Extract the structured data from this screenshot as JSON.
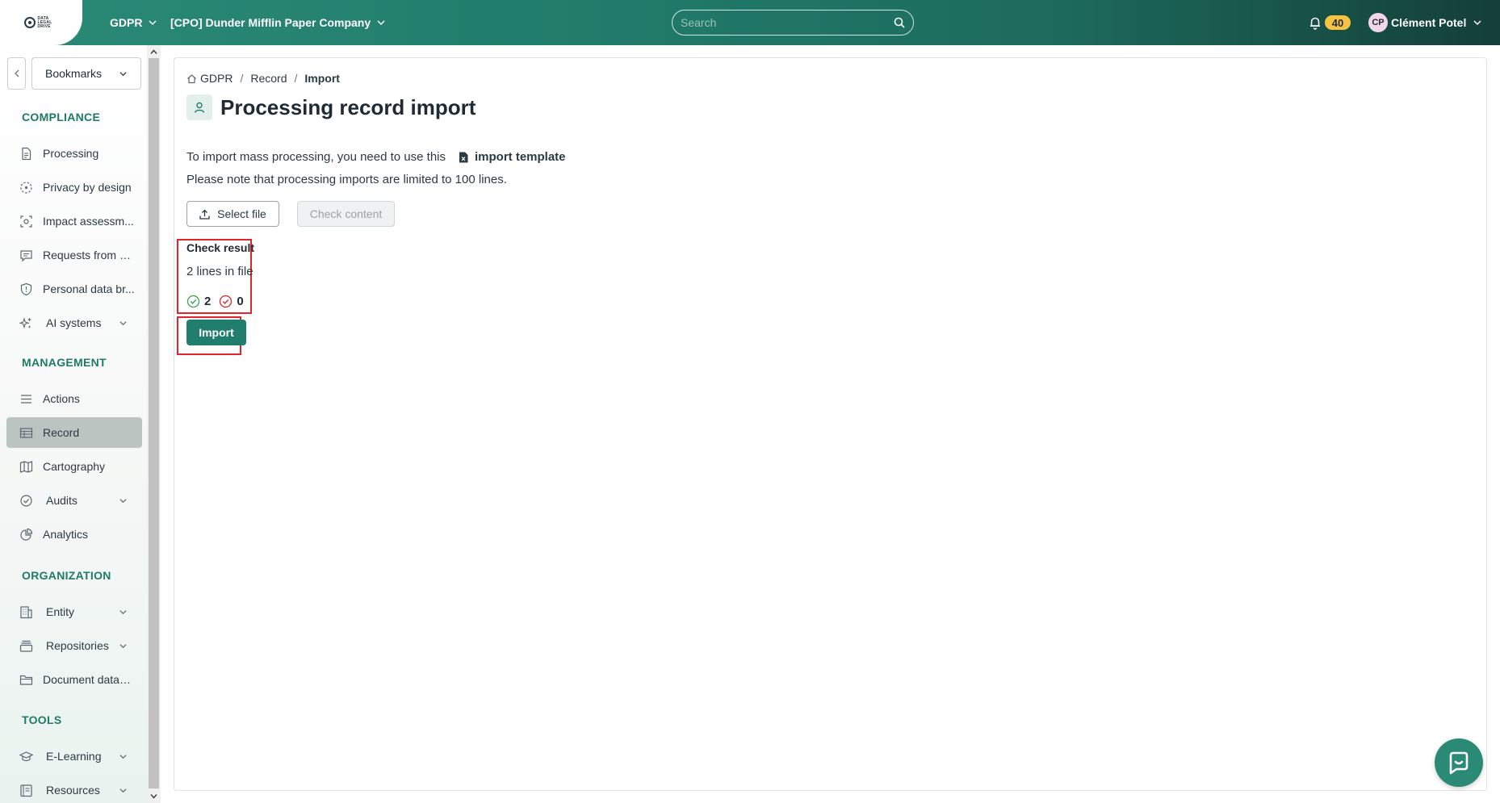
{
  "logo": {
    "text": "DATA LEGAL DRIVE"
  },
  "topbar": {
    "module": "GDPR",
    "company": "[CPO] Dunder Mifflin Paper Company",
    "search_placeholder": "Search",
    "notifications_count": "40",
    "avatar_initials": "CP",
    "user_name": "Clément Potel"
  },
  "sidebar": {
    "bookmarks_label": "Bookmarks",
    "sections": {
      "compliance": "COMPLIANCE",
      "management": "MANAGEMENT",
      "organization": "ORGANIZATION",
      "tools": "TOOLS"
    },
    "items": {
      "processing": "Processing",
      "privacy_by_design": "Privacy by design",
      "impact_assessment": "Impact assessm...",
      "requests": "Requests from d...",
      "data_breach": "Personal data br...",
      "ai_systems": "AI systems",
      "actions": "Actions",
      "record": "Record",
      "cartography": "Cartography",
      "audits": "Audits",
      "analytics": "Analytics",
      "entity": "Entity",
      "repositories": "Repositories",
      "document_database": "Document datab...",
      "elearning": "E-Learning",
      "resources": "Resources"
    }
  },
  "breadcrumb": {
    "home": "GDPR",
    "record": "Record",
    "current": "Import"
  },
  "page": {
    "title": "Processing record import",
    "info_prefix": "To import mass processing, you need to use this",
    "template_link": "import template",
    "info_limit": "Please note that processing imports are limited to 100 lines.",
    "select_file": "Select file",
    "check_content": "Check content"
  },
  "result": {
    "title": "Check result",
    "lines": "2 lines in file",
    "valid_count": "2",
    "invalid_count": "0"
  },
  "import_button": "Import",
  "colors": {
    "brand": "#227e6c",
    "highlight": "#e0262a",
    "badge": "#f5c341",
    "active_nav": "#bcc4c2"
  }
}
